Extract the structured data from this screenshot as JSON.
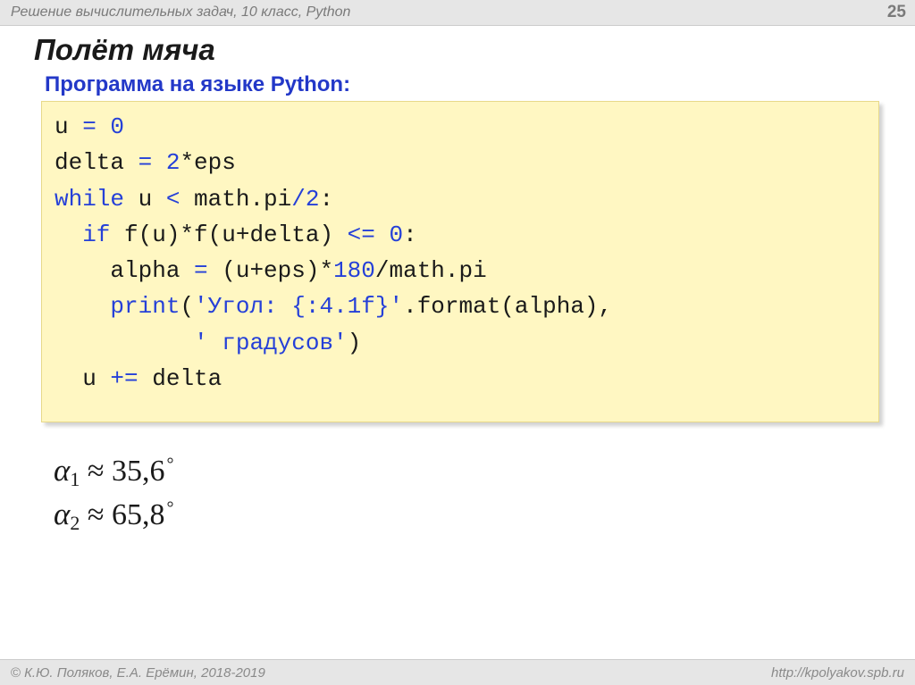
{
  "header": {
    "breadcrumb": "Решение  вычислительных задач, 10 класс, Python",
    "page_number": "25"
  },
  "slide": {
    "title": "Полёт мяча",
    "subtitle": "Программа на языке Python:"
  },
  "code": {
    "t1a": "u ",
    "t1b": "=",
    "t1c": " 0",
    "t2a": "delta ",
    "t2b": "=",
    "t2c": " 2",
    "t2d": "*eps",
    "t3a": "while",
    "t3b": " u ",
    "t3c": "<",
    "t3d": " math.pi",
    "t3e": "/",
    "t3f": "2",
    "t3g": ":",
    "t4a": "  if",
    "t4b": " f(u)*f(u+delta) ",
    "t4c": "<=",
    "t4d": " 0",
    "t4e": ":",
    "t5a": "    alpha ",
    "t5b": "=",
    "t5c": " (u+eps)*",
    "t5d": "180",
    "t5e": "/math.pi",
    "t6a": "    print",
    "t6b": "(",
    "t6c": "'Угол: {:4.1f}'",
    "t6d": ".format(alpha),",
    "t7a": "          ",
    "t7b": "' градусов'",
    "t7c": ")",
    "t8a": "  u ",
    "t8b": "+=",
    "t8c": " delta"
  },
  "results": {
    "line1": {
      "var": "α",
      "sub": "1",
      "approx": " ≈ ",
      "val": "35,6",
      "deg": "°"
    },
    "line2": {
      "var": "α",
      "sub": "2",
      "approx": " ≈ ",
      "val": "65,8",
      "deg": "°"
    }
  },
  "footer": {
    "copyright": "К.Ю. Поляков, Е.А. Ерёмин, 2018-2019",
    "copy_symbol": "©",
    "url": "http://kpolyakov.spb.ru"
  }
}
